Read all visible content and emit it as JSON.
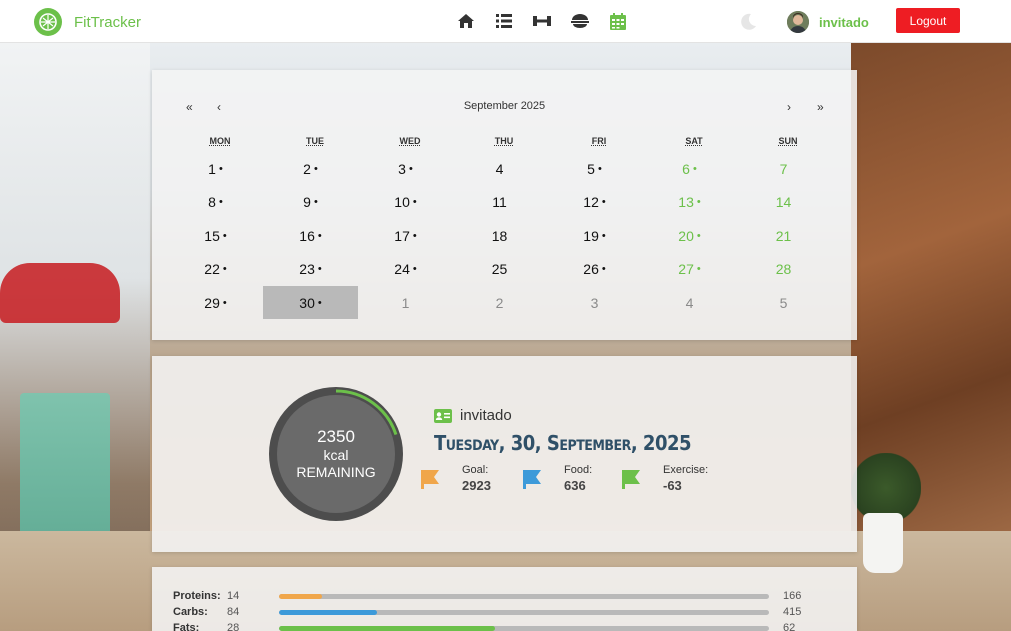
{
  "app": {
    "name": "FitTracker"
  },
  "nav": {
    "icons": [
      "home-icon",
      "list-icon",
      "dumbbell-icon",
      "bowl-icon",
      "calendar-icon"
    ],
    "theme_toggle": "moon-icon",
    "user": "invitado",
    "logout_label": "Logout"
  },
  "calendar": {
    "first": "«",
    "prev": "‹",
    "title": "September 2025",
    "next": "›",
    "last": "»",
    "weekdays": [
      "MON",
      "TUE",
      "WED",
      "THU",
      "FRI",
      "SAT",
      "SUN"
    ],
    "weeks": [
      [
        {
          "d": "1",
          "dot": true
        },
        {
          "d": "2",
          "dot": true
        },
        {
          "d": "3",
          "dot": true
        },
        {
          "d": "4",
          "dot": false
        },
        {
          "d": "5",
          "dot": true
        },
        {
          "d": "6",
          "dot": true
        },
        {
          "d": "7",
          "dot": false
        }
      ],
      [
        {
          "d": "8",
          "dot": true
        },
        {
          "d": "9",
          "dot": true
        },
        {
          "d": "10",
          "dot": true
        },
        {
          "d": "11",
          "dot": false
        },
        {
          "d": "12",
          "dot": true
        },
        {
          "d": "13",
          "dot": true
        },
        {
          "d": "14",
          "dot": false
        }
      ],
      [
        {
          "d": "15",
          "dot": true
        },
        {
          "d": "16",
          "dot": true
        },
        {
          "d": "17",
          "dot": true
        },
        {
          "d": "18",
          "dot": false
        },
        {
          "d": "19",
          "dot": true
        },
        {
          "d": "20",
          "dot": true
        },
        {
          "d": "21",
          "dot": false
        }
      ],
      [
        {
          "d": "22",
          "dot": true
        },
        {
          "d": "23",
          "dot": true
        },
        {
          "d": "24",
          "dot": true
        },
        {
          "d": "25",
          "dot": false
        },
        {
          "d": "26",
          "dot": true
        },
        {
          "d": "27",
          "dot": true
        },
        {
          "d": "28",
          "dot": false
        }
      ],
      [
        {
          "d": "29",
          "dot": true
        },
        {
          "d": "30",
          "dot": true,
          "selected": true
        },
        {
          "d": "1",
          "other": true
        },
        {
          "d": "2",
          "other": true
        },
        {
          "d": "3",
          "other": true
        },
        {
          "d": "4",
          "other": true
        },
        {
          "d": "5",
          "other": true
        }
      ]
    ],
    "dot_char": "•"
  },
  "summary": {
    "remaining_kcal": "2350",
    "unit": "kcal",
    "remaining_label": "REMAINING",
    "progress_fraction": 0.2,
    "user": "invitado",
    "date": "Tuesday, 30, September, 2025",
    "stats": [
      {
        "label": "Goal:",
        "value": "2923",
        "color": "#f0a64a"
      },
      {
        "label": "Food:",
        "value": "636",
        "color": "#3d9ad9"
      },
      {
        "label": "Exercise:",
        "value": "-63",
        "color": "#6cc04a"
      }
    ]
  },
  "macros": [
    {
      "name": "Proteins:",
      "value": "14",
      "goal": "166",
      "fraction": 0.088,
      "color": "#f0a64a"
    },
    {
      "name": "Carbs:",
      "value": "84",
      "goal": "415",
      "fraction": 0.2,
      "color": "#3d9ad9"
    },
    {
      "name": "Fats:",
      "value": "28",
      "goal": "62",
      "fraction": 0.44,
      "color": "#6cc04a"
    }
  ],
  "colors": {
    "accent": "#6cc04a",
    "danger": "#ee1d23",
    "date": "#2f5068"
  }
}
